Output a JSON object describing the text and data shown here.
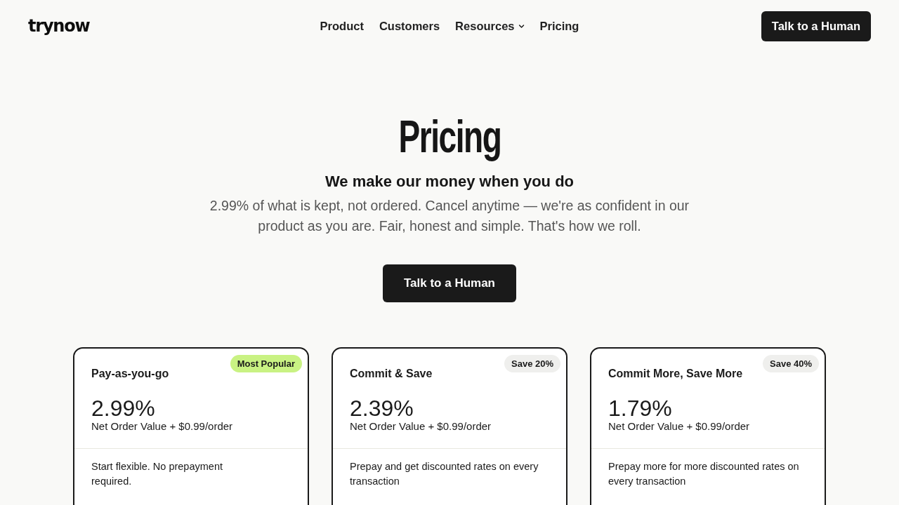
{
  "header": {
    "logo": "trynow",
    "nav": [
      {
        "label": "Product",
        "dropdown": false
      },
      {
        "label": "Customers",
        "dropdown": false
      },
      {
        "label": "Resources",
        "dropdown": true
      },
      {
        "label": "Pricing",
        "dropdown": false
      }
    ],
    "cta": "Talk to a Human"
  },
  "hero": {
    "title": "Pricing",
    "subtitle": "We make our money when you do",
    "description": "2.99% of what is kept, not ordered. Cancel anytime — we're as confident in our product as you are. Fair, honest and simple. That's how we roll.",
    "cta": "Talk to a Human"
  },
  "plans": [
    {
      "name": "Pay-as-you-go",
      "badge": {
        "label": "Most Popular",
        "color": "#c9f283"
      },
      "rate": "2.99%",
      "rate_note": "Net Order Value + $0.99/order",
      "description": "Start flexible. No prepayment required."
    },
    {
      "name": "Commit & Save",
      "badge": {
        "label": "Save 20%",
        "color": "#efefed"
      },
      "rate": "2.39%",
      "rate_note": "Net Order Value + $0.99/order",
      "description": "Prepay and get discounted rates on every transaction"
    },
    {
      "name": "Commit More, Save More",
      "badge": {
        "label": "Save 40%",
        "color": "#efefed"
      },
      "rate": "1.79%",
      "rate_note": "Net Order Value + $0.99/order",
      "description": "Prepay more for more discounted rates on every transaction"
    }
  ]
}
